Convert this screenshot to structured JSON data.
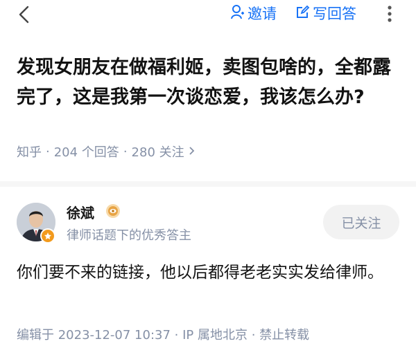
{
  "header": {
    "back_icon": "chevron-left-icon",
    "invite_label": "邀请",
    "write_answer_label": "写回答",
    "accent": "#1772f6"
  },
  "question": {
    "title": "发现女朋友在做福利姬，卖图包啥的，全都露完了，这是我第一次谈恋爱，我该怎么办?",
    "source": "知乎",
    "answers": "204 个回答",
    "followers": "280 关注"
  },
  "answer": {
    "author_name": "徐斌",
    "author_bio": "律师话题下的优秀答主",
    "follow_label": "已关注",
    "content": "你们要不来的链接，他以后都得老老实实发给律师。",
    "footer": "编辑于 2023-12-07 10:37 · IP 属地北京 · 禁止转载"
  }
}
